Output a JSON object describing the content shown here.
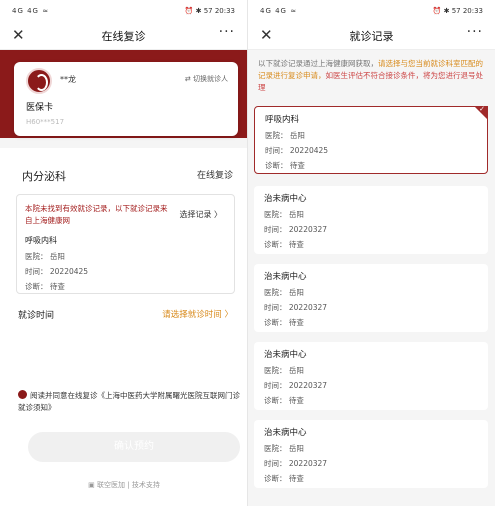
{
  "left": {
    "status": {
      "left": "4G 4G ≈",
      "right": "⏰ ✱ 57 20:33"
    },
    "nav": {
      "title": "在线复诊",
      "close": "✕",
      "more": "···"
    },
    "patient": {
      "name": "**龙",
      "switch_label": "⇄ 切换就诊人",
      "card_type": "医保卡",
      "card_no": "H60***517"
    },
    "dept": {
      "name": "内分泌科",
      "tag": "在线复诊"
    },
    "record": {
      "notice": "本院未找到有效就诊记录，以下就诊记录来自上海健康网",
      "select_label": "选择记录 〉",
      "dept": "呼吸内科",
      "hospital": "医院：  岳阳",
      "time": "时间：  20220425",
      "diagnosis": "诊断：  待查"
    },
    "visit": {
      "label": "就诊时间",
      "select": "请选择就诊时间 〉"
    },
    "agree_text": "阅读并同意在线复诊《上海中医药大学附属曙光医院互联网门诊就诊须知》",
    "confirm_label": "确认预约",
    "footer": "▣ 联空医加 | 技术支持"
  },
  "right": {
    "status": {
      "left": "4G 4G ≈",
      "right": "⏰ ✱ 57 20:33"
    },
    "nav": {
      "title": "就诊记录",
      "close": "✕",
      "more": "···"
    },
    "tip": {
      "part1": "以下就诊记录通过上海健康网获取，",
      "part2": "请选择与您当前就诊科室匹配的记录进行复诊申请，",
      "part3": "如医生评估不符合接诊条件，将为您进行退号处理"
    },
    "records": [
      {
        "dept": "呼吸内科",
        "hospital": "医院：  岳阳",
        "time": "时间：  20220425",
        "diagnosis": "诊断：  待查"
      },
      {
        "dept": "治未病中心",
        "hospital": "医院：  岳阳",
        "time": "时间：  20220327",
        "diagnosis": "诊断：  待查"
      },
      {
        "dept": "治未病中心",
        "hospital": "医院：  岳阳",
        "time": "时间：  20220327",
        "diagnosis": "诊断：  待查"
      },
      {
        "dept": "治未病中心",
        "hospital": "医院：  岳阳",
        "time": "时间：  20220327",
        "diagnosis": "诊断：  待查"
      },
      {
        "dept": "治未病中心",
        "hospital": "医院：  岳阳",
        "time": "时间：  20220327",
        "diagnosis": "诊断：  待查"
      }
    ],
    "selected_check": "✓"
  },
  "colors": {
    "brand": "#8b1a1a",
    "accent_orange": "#d88a1b",
    "notice_red": "#a31d1d"
  }
}
